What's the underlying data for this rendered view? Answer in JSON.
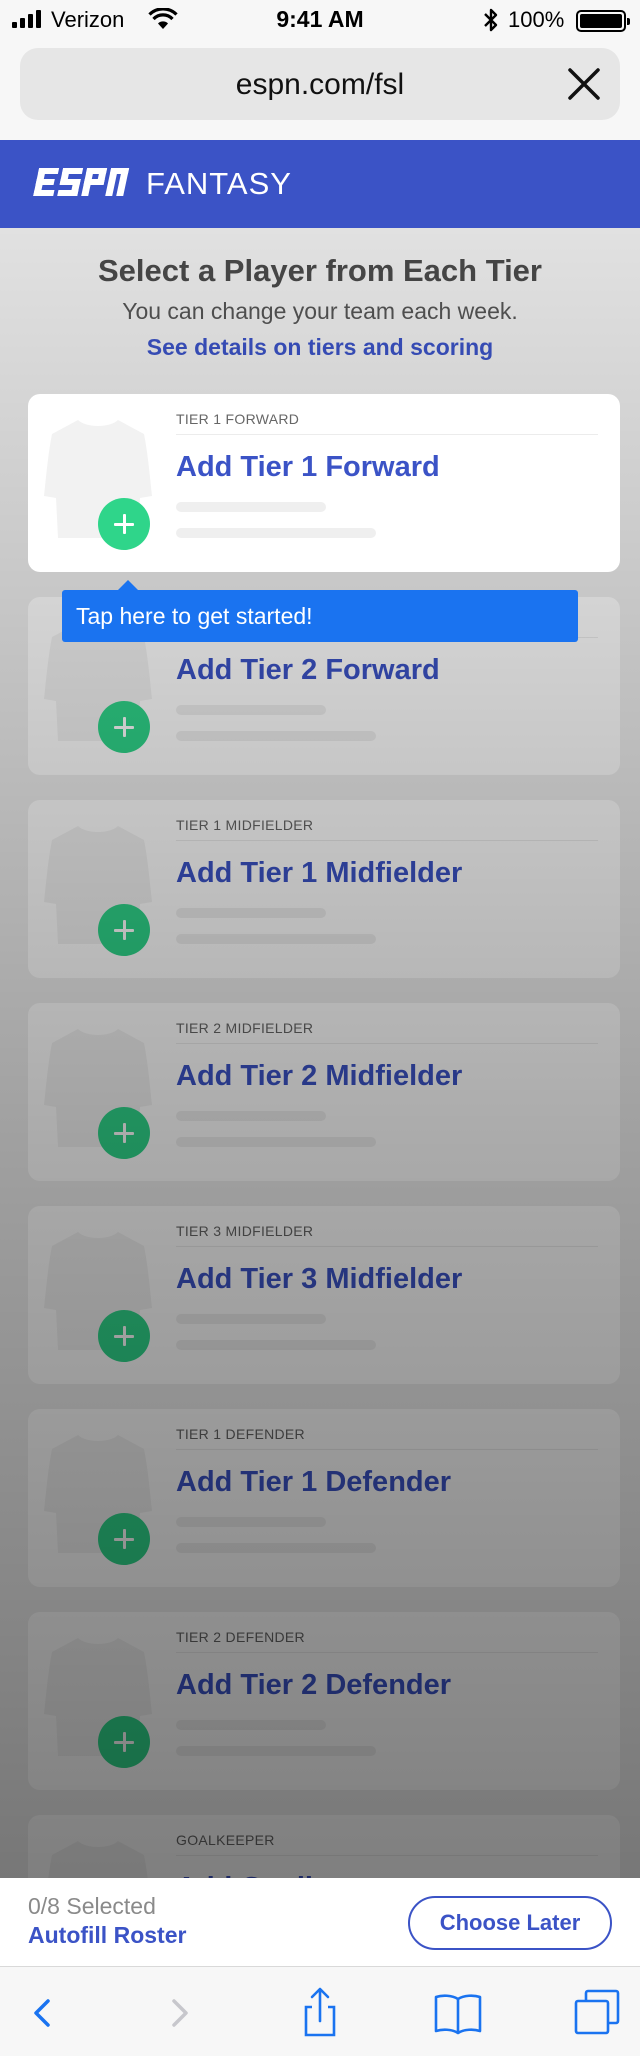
{
  "status_bar": {
    "carrier": "Verizon",
    "time": "9:41 AM",
    "battery": "100%"
  },
  "browser": {
    "url": "espn.com/fsl"
  },
  "brand": {
    "name": "ESPN",
    "product": "FANTASY",
    "color": "#3b53c6"
  },
  "page": {
    "heading": "Select a Player from Each Tier",
    "subheading": "You can change your team each week.",
    "details_link": "See details on tiers and scoring"
  },
  "tooltip": {
    "text": "Tap here to get started!"
  },
  "tiers": [
    {
      "label": "TIER 1 FORWARD",
      "action": "Add Tier 1 Forward"
    },
    {
      "label": "",
      "action": "Add Tier 2 Forward"
    },
    {
      "label": "TIER 1 MIDFIELDER",
      "action": "Add Tier 1 Midfielder"
    },
    {
      "label": "TIER 2 MIDFIELDER",
      "action": "Add Tier 2 Midfielder"
    },
    {
      "label": "TIER 3 MIDFIELDER",
      "action": "Add Tier 3 Midfielder"
    },
    {
      "label": "TIER 1 DEFENDER",
      "action": "Add Tier 1 Defender"
    },
    {
      "label": "TIER 2 DEFENDER",
      "action": "Add Tier 2 Defender"
    },
    {
      "label": "GOALKEEPER",
      "action": "Add Goalkeeper"
    }
  ],
  "footer": {
    "selected_count": "0/8 Selected",
    "autofill": "Autofill Roster",
    "choose_later": "Choose Later"
  },
  "safari_toolbar": {
    "icons": [
      "back-icon",
      "forward-icon",
      "share-icon",
      "bookmarks-icon",
      "tabs-icon"
    ]
  }
}
